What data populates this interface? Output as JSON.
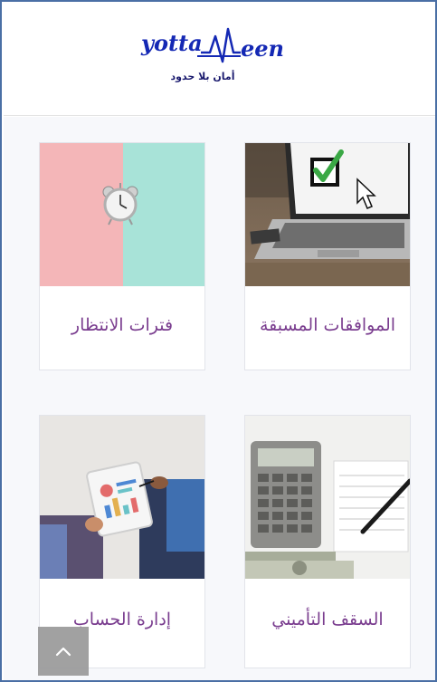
{
  "header": {
    "logo_left": "yotta",
    "logo_right": "een",
    "tagline": "أمان بلا حدود"
  },
  "cards": [
    {
      "title": "الموافقات المسبقة",
      "image": "laptop-checkbox"
    },
    {
      "title": "فترات الانتظار",
      "image": "alarm-clock"
    },
    {
      "title": "السقف التأميني",
      "image": "calculator-cash"
    },
    {
      "title": "إدارة الحساب",
      "image": "tablet-meeting"
    }
  ],
  "colors": {
    "title": "#7a3d8f",
    "logo": "#1428b4",
    "frame": "#4a6fa5"
  },
  "scroll_top": {
    "icon": "chevron-up-icon"
  }
}
